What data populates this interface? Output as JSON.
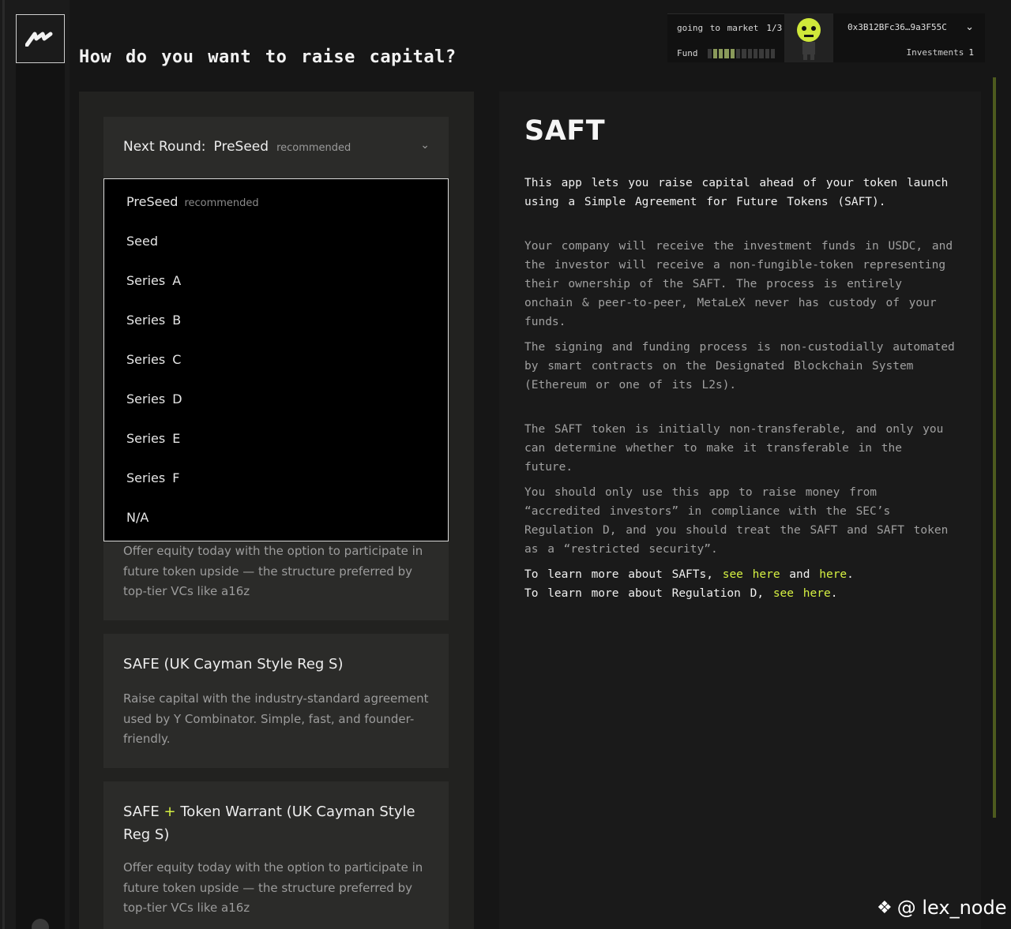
{
  "page": {
    "title": "How do you want to raise capital?"
  },
  "header": {
    "status_label": "going to market",
    "status_count": "1/3",
    "fund_label": "Fund",
    "wallet_address": "0x3B12BFc36…9a3F55C",
    "investments_label": "Investments",
    "investments_count": "1"
  },
  "round_select": {
    "label": "Next Round:",
    "value": "PreSeed",
    "tag": "recommended"
  },
  "dropdown": {
    "options": [
      {
        "label": "PreSeed",
        "tag": "recommended"
      },
      {
        "label": "Seed"
      },
      {
        "label": "Series A"
      },
      {
        "label": "Series B"
      },
      {
        "label": "Series C"
      },
      {
        "label": "Series D"
      },
      {
        "label": "Series E"
      },
      {
        "label": "Series F"
      },
      {
        "label": "N/A"
      }
    ]
  },
  "cards": [
    {
      "description": "Offer equity today with the option to participate in future token upside — the structure preferred by top-tier VCs like a16z"
    },
    {
      "title": "SAFE (UK Cayman Style Reg S)",
      "description": "Raise capital with the industry-standard agreement used by Y Combinator. Simple, fast, and founder-friendly."
    },
    {
      "title_a": "SAFE",
      "title_plus": "+",
      "title_b": "Token Warrant (UK Cayman Style Reg S)",
      "description": "Offer equity today with the option to participate in future token upside — the structure preferred by top-tier VCs like a16z"
    }
  ],
  "detail": {
    "title": "SAFT",
    "p1": "This app lets you raise capital ahead of your token launch using a Simple Agreement for Future Tokens (SAFT).",
    "p2": "Your company will receive the investment funds in USDC, and the investor will receive a non-fungible-token representing their ownership of the SAFT. The process is entirely onchain & peer-to-peer, MetaLeX never has custody of your funds.",
    "p3": "The signing and funding process is non-custodially automated by smart contracts on the Designated Blockchain System (Ethereum or one of its L2s).",
    "p4": "The SAFT token is initially non-transferable, and only you can determine whether to make it transferable in the future.",
    "p5": "You should only use this app to raise money from “accredited investors” in compliance with the SEC’s Regulation D, and you should treat the SAFT and SAFT token as a “restricted security”.",
    "learn1_prefix": "To learn more about SAFTs,",
    "learn1_link1": "see here",
    "learn1_and": "and",
    "learn1_link2": "here",
    "learn2_prefix": "To learn more about Regulation D,",
    "learn2_link1": "see",
    "learn2_link2": "here"
  },
  "watermark": "@ lex_node",
  "icons": {
    "logo": "metalex-logo",
    "chevron": "chevron-down-icon",
    "watermark": "binance-icon"
  }
}
